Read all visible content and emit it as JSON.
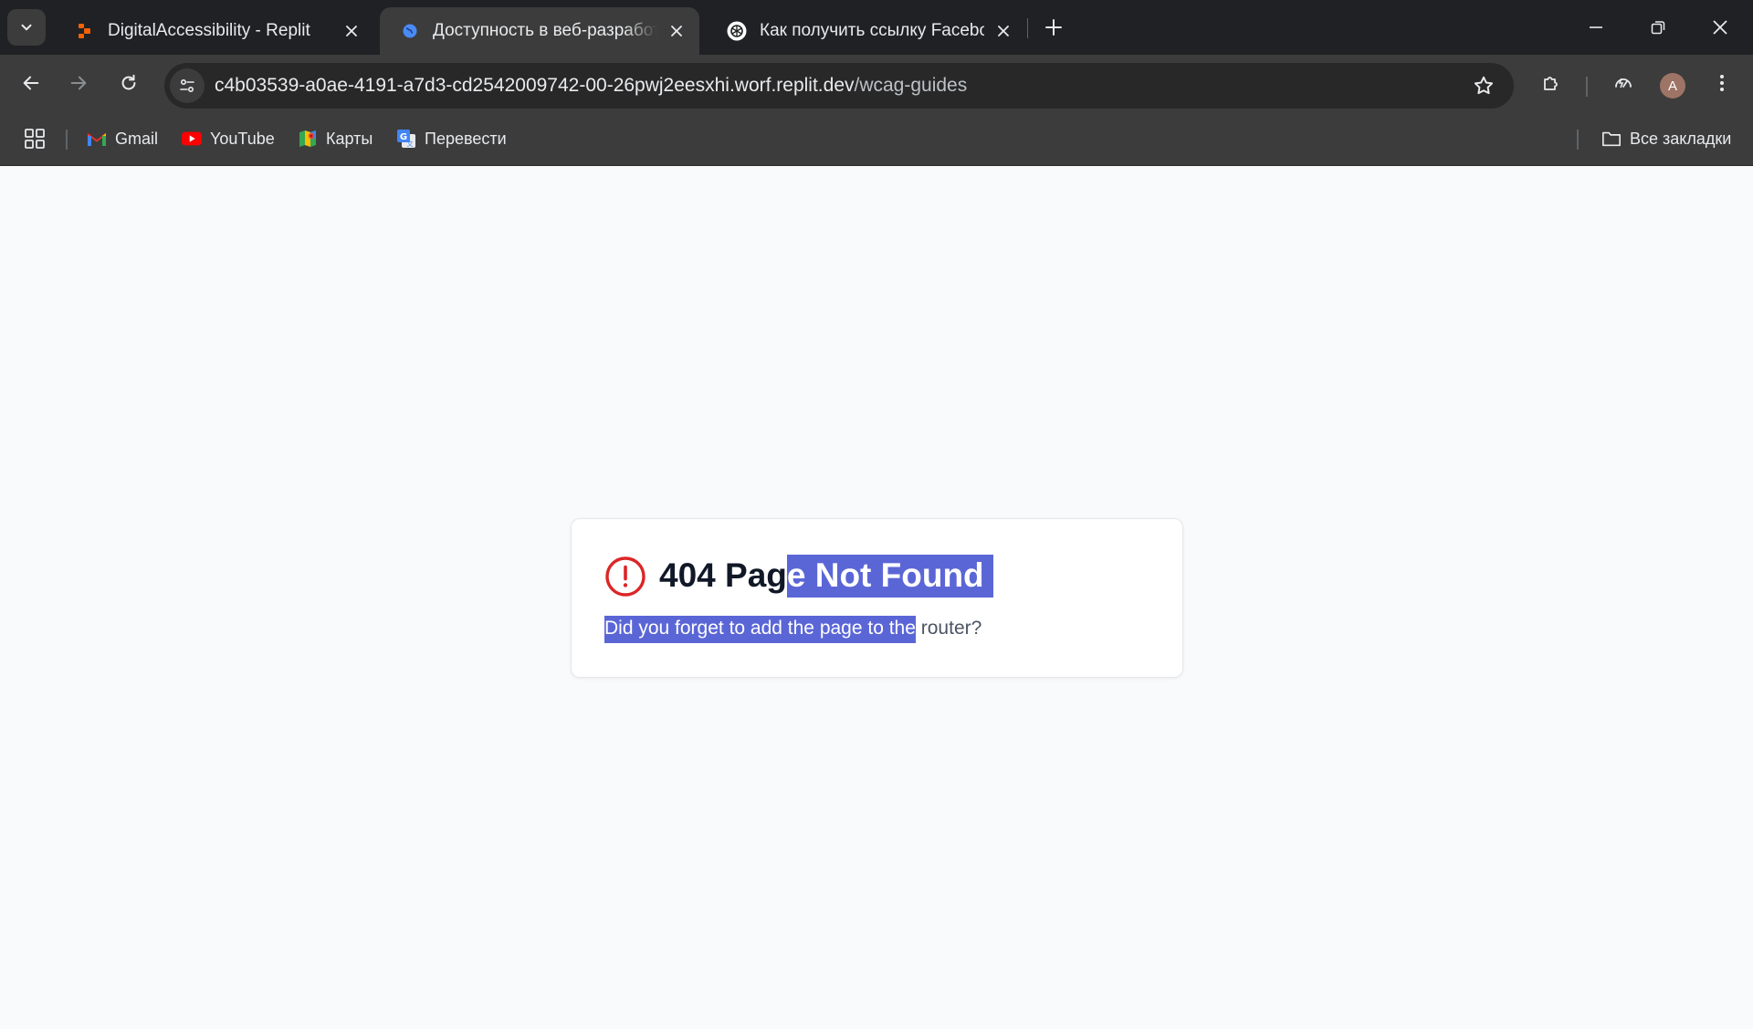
{
  "browser": {
    "tabs": [
      {
        "title": "DigitalAccessibility - Replit",
        "active": false,
        "favicon": "replit-icon"
      },
      {
        "title": "Доступность в веб-разработке",
        "active": true,
        "favicon": "globe-icon"
      },
      {
        "title": "Как получить ссылку Facebook",
        "active": false,
        "favicon": "openai-icon"
      }
    ],
    "url_host": "c4b03539-a0ae-4191-a7d3-cd2542009742-00-26pwj2eesxhi.worf.replit.dev",
    "url_path": "/wcag-guides",
    "profile_initial": "A",
    "bookmarks": [
      {
        "label": "Gmail",
        "icon": "gmail-icon"
      },
      {
        "label": "YouTube",
        "icon": "youtube-icon"
      },
      {
        "label": "Карты",
        "icon": "maps-icon"
      },
      {
        "label": "Перевести",
        "icon": "translate-icon"
      }
    ],
    "all_bookmarks_label": "Все закладки"
  },
  "page": {
    "title_plain": "404 Pag",
    "title_selected": "e Not Found",
    "desc_selected": "Did you forget to add the page to the",
    "desc_plain": " router?"
  },
  "colors": {
    "selection": "#5b66d6",
    "error_icon": "#dc2626",
    "title_text": "#111827",
    "desc_text": "#4b5563",
    "page_bg": "#f9fafb"
  }
}
